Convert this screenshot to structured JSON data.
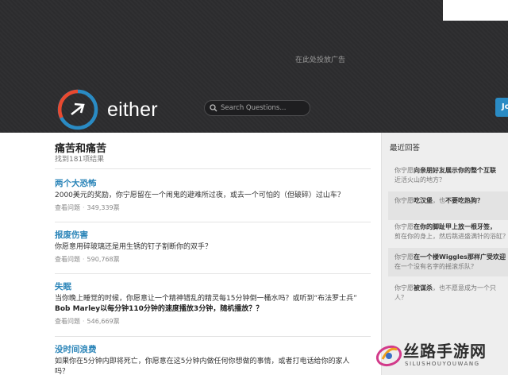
{
  "header": {
    "ad_text": "在此处投放广告",
    "brand": "either",
    "search_placeholder": "Search Questions...",
    "join_label": "Jo",
    "brand_colors": {
      "ring_red": "#e8492f",
      "ring_blue": "#2a8bc4",
      "bg": "#2c2c2e"
    }
  },
  "main": {
    "title": "痛苦和痛苦",
    "result_count": "找到181项结果",
    "questions": [
      {
        "title": "两个大恐怖",
        "desc": "2000美元的奖励，你宁愿留在一个闹鬼的避难所过夜，或去一个可怕的（但破碎）过山车？",
        "views_label": "查看问题",
        "votes": "349,339票"
      },
      {
        "title": "报废伤害",
        "desc": "你愿意用碎玻璃还是用生锈的钉子割断你的双手？",
        "views_label": "查看问题",
        "votes": "590,768票"
      },
      {
        "title": "失眠",
        "desc_1": "当你晚上睡觉的时候，你愿意让一个精神错乱的精灵每15分钟倒一桶水吗？或听到“布法罗士兵”",
        "desc_2": "Bob Marley以每分钟110分钟的速度播放3分钟，随机播放？？",
        "views_label": "查看问题",
        "votes": "546,669票"
      },
      {
        "title": "没时间浪费",
        "desc_1": "如果你在5分钟内即将死亡，你愿意在这5分钟内做任何你想做的事情，或者打电话给你的家人",
        "desc_2": "吗？"
      }
    ]
  },
  "sidebar": {
    "title": "最近回答",
    "items": [
      {
        "prefix": "你宁愿",
        "hl": "向亲朋好友展示你的整个互联",
        "line2": "近活火山的地方？"
      },
      {
        "prefix": "你宁愿",
        "hl": "吃汉堡",
        "mid": "，也",
        "rest": "不要吃热狗？"
      },
      {
        "prefix": "你宁愿",
        "hl": "在你的脚趾甲上放一根牙签，",
        "line2": "剪在你的身上，然后跳进盛满针的浴缸？"
      },
      {
        "prefix": "你宁愿",
        "hl": "在一个楼Wiggles那样广受欢迎",
        "line2": "在一个没有名字的摇滚乐队？"
      },
      {
        "prefix": "你宁愿",
        "hl": "被谋杀",
        "mid": "，也",
        "rest": "不愿意成为一个只",
        "line2": "人？"
      }
    ]
  },
  "watermark": {
    "title": "丝路手游网",
    "subtitle": "SILUSHOUYOUWANG"
  }
}
